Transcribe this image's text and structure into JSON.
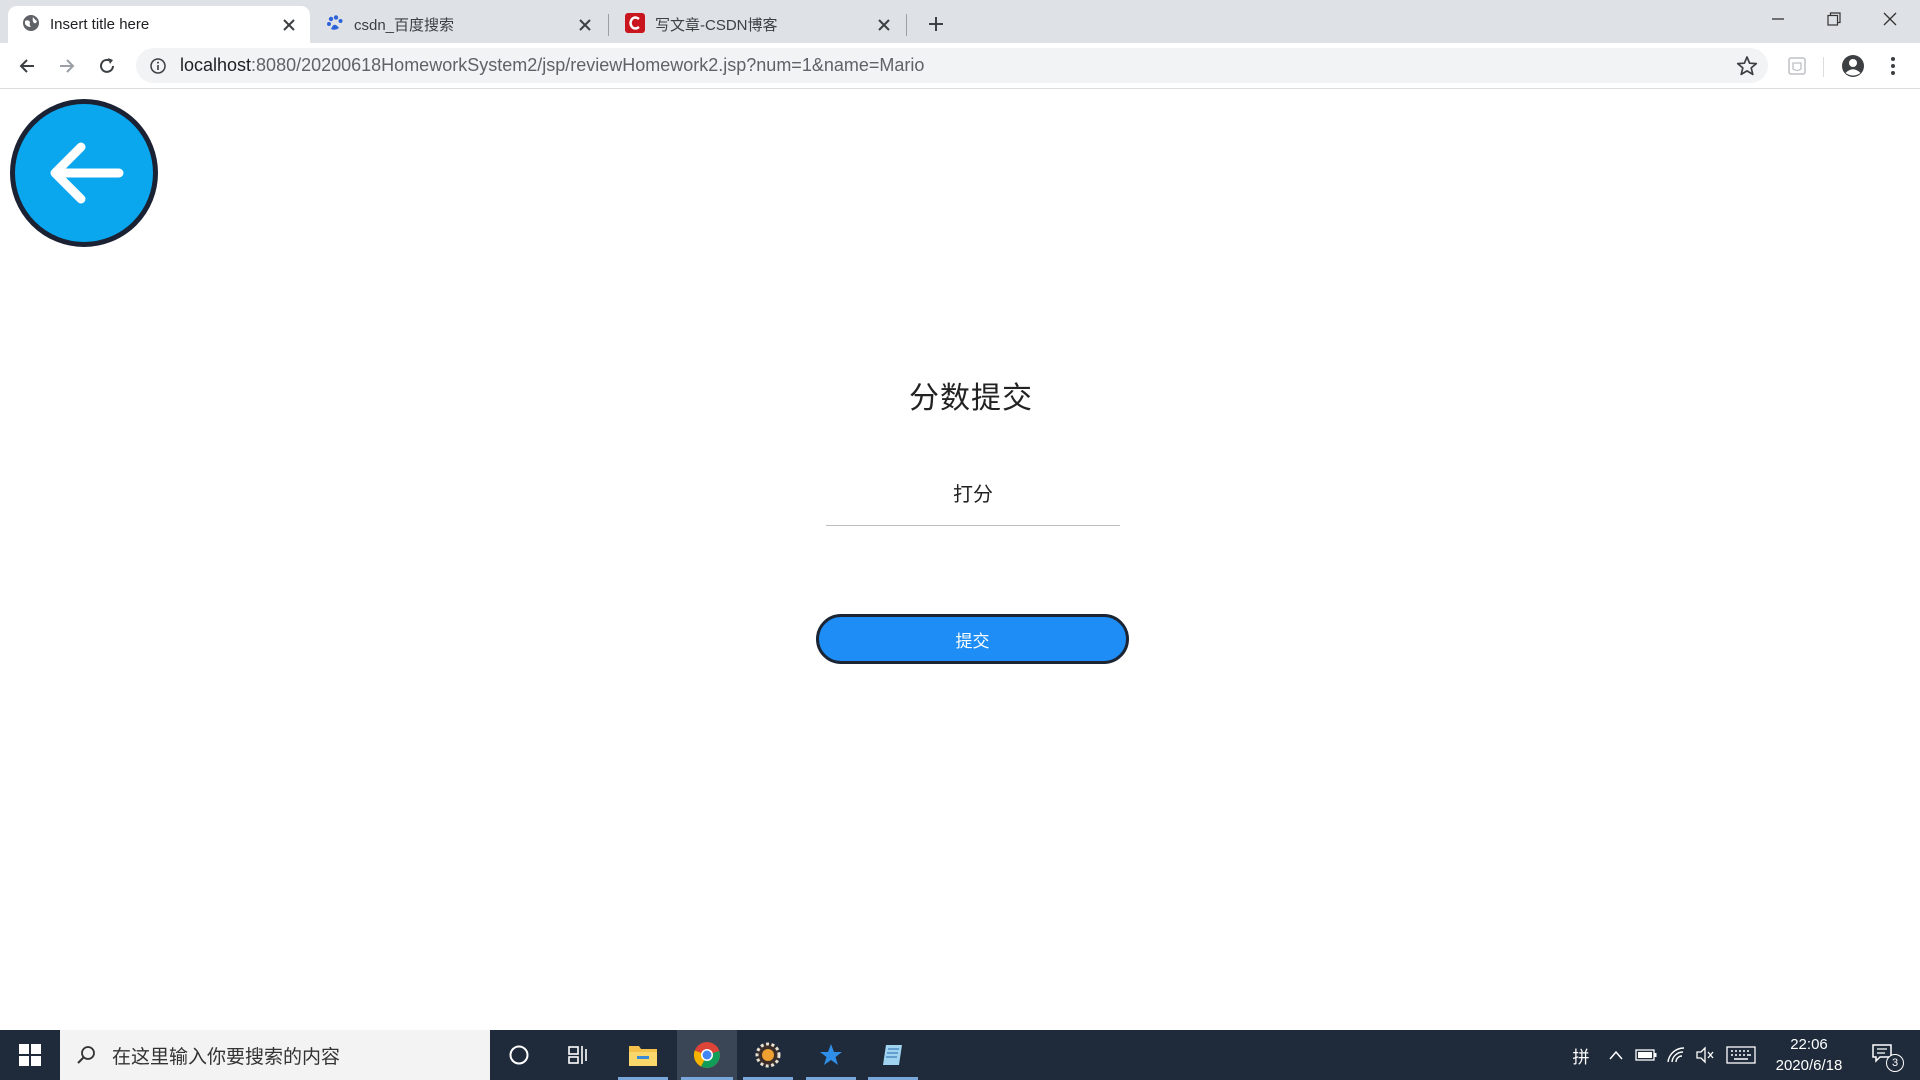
{
  "browser": {
    "tabs": [
      {
        "title": "Insert title here",
        "icon": "globe-icon",
        "active": true
      },
      {
        "title": "csdn_百度搜索",
        "icon": "baidu-paw-icon",
        "active": false
      },
      {
        "title": "写文章-CSDN博客",
        "icon": "csdn-logo-icon",
        "active": false
      }
    ],
    "url_host": "localhost",
    "url_rest": ":8080/20200618HomeworkSystem2/jsp/reviewHomework2.jsp?num=1&name=Mario"
  },
  "page": {
    "title": "分数提交",
    "score_placeholder": "打分",
    "score_value": "",
    "submit_label": "提交",
    "back_icon": "arrow-left-icon"
  },
  "taskbar": {
    "search_placeholder": "在这里输入你要搜索的内容",
    "ime_label": "拼",
    "time": "22:06",
    "date": "2020/6/18",
    "notification_count": "3"
  },
  "colors": {
    "back_button_fill": "#0aa6ee",
    "submit_button_fill": "#1e8df5",
    "taskbar_bg": "#1f2b3a",
    "tabbar_bg": "#dee1e6"
  }
}
